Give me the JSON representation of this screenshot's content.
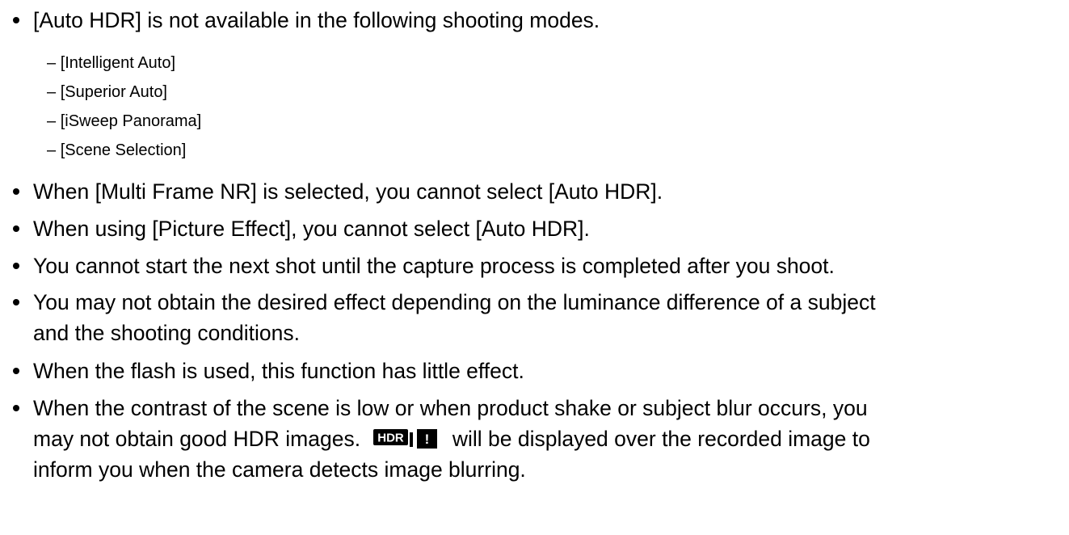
{
  "notes": {
    "auto_hdr_unavailable": {
      "text": "[Auto HDR] is not available in the following shooting modes.",
      "modes": [
        {
          "dash": "–",
          "label": "[Intelligent Auto]"
        },
        {
          "dash": "–",
          "label": "[Superior Auto]"
        },
        {
          "dash": "–",
          "label": "[iSweep Panorama]"
        },
        {
          "dash": "–",
          "label": "[Scene Selection]"
        }
      ]
    },
    "multi_frame_nr": "When [Multi Frame NR] is selected, you cannot select [Auto HDR].",
    "picture_effect": "When using [Picture Effect], you cannot select [Auto HDR].",
    "capture_process": "You cannot start the next shot until the capture process is completed after you shoot.",
    "luminance": {
      "line1": "You may not obtain the desired effect depending on the luminance difference of a subject",
      "line2": "and the shooting conditions."
    },
    "flash": "When the flash is used, this function has little effect.",
    "low_contrast": {
      "line1": "When the contrast of the scene is low or when product shake or subject blur occurs, you",
      "line2_before": "may not obtain good HDR images.",
      "icon_hdr_text": "HDR",
      "icon_warning_text": "!",
      "line2_after": "will be displayed over the recorded image to",
      "line3": "inform you when the camera detects image blurring."
    }
  }
}
